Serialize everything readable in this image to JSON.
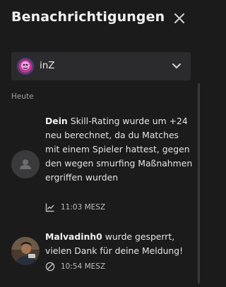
{
  "header": {
    "title": "Benachrichtigungen",
    "close_icon": "close-icon"
  },
  "account_selector": {
    "selected": "inZ",
    "avatar_icon": "account-avatar",
    "chevron_icon": "chevron-down-icon"
  },
  "section": {
    "label": "Heute"
  },
  "notifications": [
    {
      "bold": "Dein",
      "text": " Skill-Rating wurde um +24 neu berechnet, da du Matches mit einem Spieler hattest, gegen den wegen smurfing Maßnahmen ergriffen wurden",
      "time": "11:03 MESZ",
      "icon": "trend-chart-icon",
      "avatar_icon": "user-placeholder-icon"
    },
    {
      "bold": "Malvadinh0",
      "text": " wurde gesperrt, vielen Dank für deine Meldung!",
      "time": "10:54 MESZ",
      "icon": "ban-icon",
      "avatar_icon": "user-photo-avatar"
    }
  ],
  "colors": {
    "background": "#1b1b1c",
    "dropdown": "#2b2b2d",
    "text": "#e4e4e4",
    "muted": "#a0a0a0"
  }
}
